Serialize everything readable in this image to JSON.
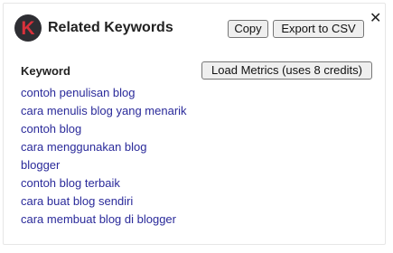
{
  "header": {
    "logo_letter": "K",
    "title": "Related Keywords",
    "copy_label": "Copy",
    "export_label": "Export to CSV",
    "close_symbol": "✕"
  },
  "table": {
    "column_header": "Keyword",
    "load_metrics_label": "Load Metrics (uses 8 credits)",
    "keywords": [
      "contoh penulisan blog",
      "cara menulis blog yang menarik",
      "contoh blog",
      "cara menggunakan blog",
      "blogger",
      "contoh blog terbaik",
      "cara buat blog sendiri",
      "cara membuat blog di blogger"
    ]
  },
  "colors": {
    "logo_bg": "#2e2e33",
    "logo_letter": "#d9313b",
    "keyword_link": "#2a2a9a"
  }
}
